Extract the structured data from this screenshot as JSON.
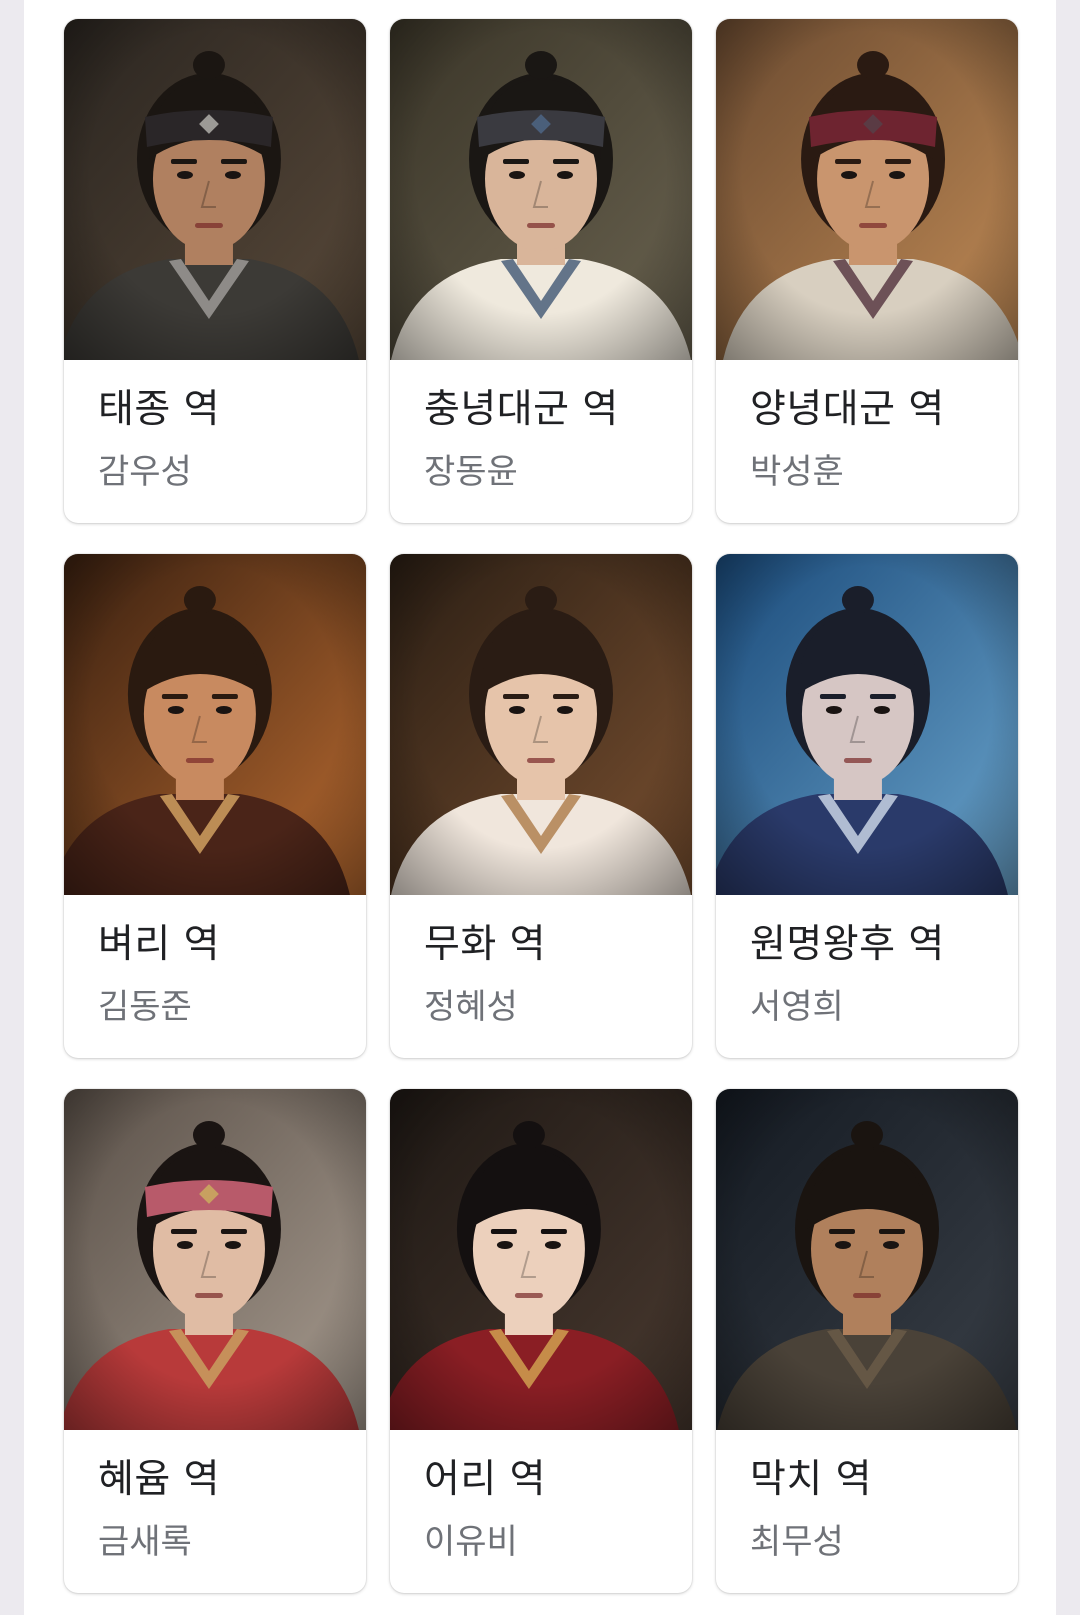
{
  "cast": [
    {
      "role": "태종 역",
      "actor": "감우성",
      "photo": {
        "bg": [
          "#2a2520",
          "#5a4a3a"
        ],
        "skin": "#b08060",
        "hair": "#1b1612",
        "headband": "#2a2628",
        "clothes": "#3c3a36",
        "accent": "#9c9a96",
        "face_x": 0.48
      }
    },
    {
      "role": "충녕대군 역",
      "actor": "장동윤",
      "photo": {
        "bg": [
          "#3a3528",
          "#6a6350"
        ],
        "skin": "#d9b59a",
        "hair": "#1a1714",
        "headband": "#3a3a40",
        "clothes": "#efe9dd",
        "accent": "#4a5f7a",
        "face_x": 0.5
      }
    },
    {
      "role": "양녕대군 역",
      "actor": "박성훈",
      "photo": {
        "bg": [
          "#6a4a30",
          "#c08a55"
        ],
        "skin": "#c9956e",
        "hair": "#2a1a12",
        "headband": "#6e2430",
        "clothes": "#d8cfc0",
        "accent": "#5a3b44",
        "face_x": 0.52
      }
    },
    {
      "role": "벼리 역",
      "actor": "김동준",
      "photo": {
        "bg": [
          "#3a2010",
          "#b86a30"
        ],
        "skin": "#c88a60",
        "hair": "#2a1a10",
        "headband": "",
        "clothes": "#4a2418",
        "accent": "#d0a060",
        "face_x": 0.45
      }
    },
    {
      "role": "무화 역",
      "actor": "정혜성",
      "photo": {
        "bg": [
          "#2a1e14",
          "#7a5030"
        ],
        "skin": "#e6c4aa",
        "hair": "#2a1c14",
        "headband": "",
        "clothes": "#f0e6dc",
        "accent": "#b08050",
        "face_x": 0.5
      }
    },
    {
      "role": "원명왕후 역",
      "actor": "서영희",
      "photo": {
        "bg": [
          "#1a4a7a",
          "#6aa4cc"
        ],
        "skin": "#d6c6c4",
        "hair": "#1a1e2a",
        "headband": "",
        "clothes": "#2a3a6a",
        "accent": "#c8d4e4",
        "face_x": 0.47
      }
    },
    {
      "role": "혜윰 역",
      "actor": "금새록",
      "photo": {
        "bg": [
          "#5a5048",
          "#a89c90"
        ],
        "skin": "#e0bca4",
        "hair": "#1a1412",
        "headband": "#b85a6a",
        "clothes": "#b83a3a",
        "accent": "#c8a060",
        "face_x": 0.48
      }
    },
    {
      "role": "어리 역",
      "actor": "이유비",
      "photo": {
        "bg": [
          "#1e1814",
          "#4a3a30"
        ],
        "skin": "#ecd0bc",
        "hair": "#141010",
        "headband": "",
        "clothes": "#8a1e24",
        "accent": "#d0a050",
        "face_x": 0.46
      }
    },
    {
      "role": "막치 역",
      "actor": "최무성",
      "photo": {
        "bg": [
          "#141a22",
          "#3a4048"
        ],
        "skin": "#b0805c",
        "hair": "#1a1410",
        "headband": "",
        "clothes": "#4a4238",
        "accent": "#6a5a48",
        "face_x": 0.5
      }
    }
  ]
}
